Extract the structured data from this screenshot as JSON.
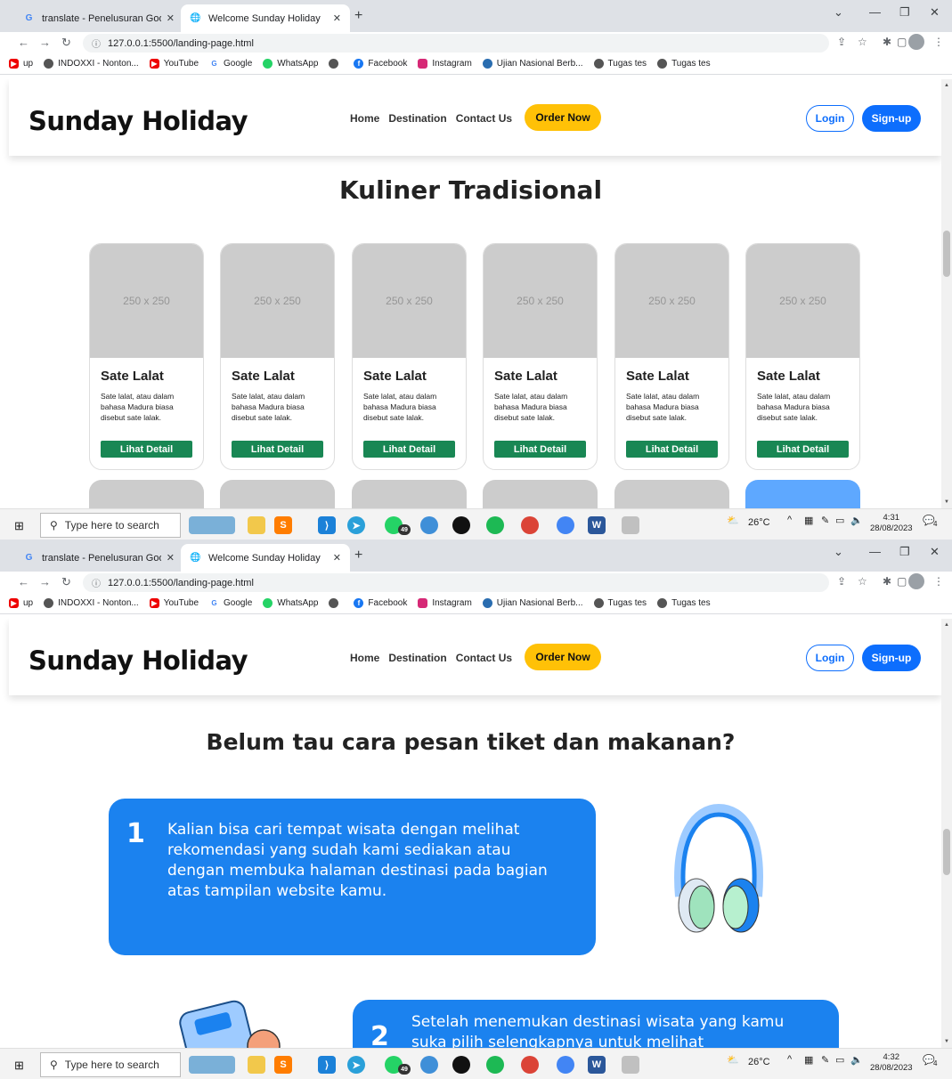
{
  "browser": {
    "tabs": [
      {
        "label": "translate - Penelusuran Google",
        "icon": "google-icon"
      },
      {
        "label": "Welcome Sunday Holiday",
        "icon": "globe-icon"
      }
    ],
    "new_tab": "+",
    "url": "127.0.0.1:5500/landing-page.html",
    "bookmarks": [
      "up",
      "INDOXXI - Nonton...",
      "YouTube",
      "Google",
      "WhatsApp",
      "",
      "Facebook",
      "Instagram",
      "Ujian Nasional Berb...",
      "Tugas tes",
      "Tugas tes"
    ]
  },
  "site": {
    "brand": "Sunday Holiday",
    "menu": [
      "Home",
      "Destination",
      "Contact Us"
    ],
    "order_label": "Order Now",
    "login_label": "Login",
    "signup_label": "Sign-up"
  },
  "section_kuliner": {
    "title": "Kuliner Tradisional",
    "cards": [
      {
        "img": "250 x 250",
        "name": "Sate Lalat",
        "desc": "Sate lalat, atau dalam bahasa Madura biasa disebut sate lalak.",
        "button": "Lihat Detail"
      },
      {
        "img": "250 x 250",
        "name": "Sate Lalat",
        "desc": "Sate lalat, atau dalam bahasa Madura biasa disebut sate lalak.",
        "button": "Lihat Detail"
      },
      {
        "img": "250 x 250",
        "name": "Sate Lalat",
        "desc": "Sate lalat, atau dalam bahasa Madura biasa disebut sate lalak.",
        "button": "Lihat Detail"
      },
      {
        "img": "250 x 250",
        "name": "Sate Lalat",
        "desc": "Sate lalat, atau dalam bahasa Madura biasa disebut sate lalak.",
        "button": "Lihat Detail"
      },
      {
        "img": "250 x 250",
        "name": "Sate Lalat",
        "desc": "Sate lalat, atau dalam bahasa Madura biasa disebut sate lalak.",
        "button": "Lihat Detail"
      },
      {
        "img": "250 x 250",
        "name": "Sate Lalat",
        "desc": "Sate lalat, atau dalam bahasa Madura biasa disebut sate lalak.",
        "button": "Lihat Detail"
      }
    ]
  },
  "section_howto": {
    "title": "Belum tau cara pesan tiket dan makanan?",
    "steps": [
      {
        "num": "1",
        "text": "Kalian bisa cari tempat wisata dengan melihat rekomendasi yang sudah kami sediakan atau dengan membuka halaman destinasi pada bagian atas tampilan website kamu."
      },
      {
        "num": "2",
        "text": "Setelah menemukan destinasi wisata yang kamu suka pilih selengkapnya untuk melihat"
      }
    ]
  },
  "taskbar": {
    "search_placeholder": "Type here to search",
    "whatsapp_badge": "49",
    "weather": "26°C",
    "shots": [
      {
        "time": "4:31",
        "date": "28/08/2023"
      },
      {
        "time": "4:32",
        "date": "28/08/2023"
      }
    ],
    "notifications": "4"
  },
  "colors": {
    "primary": "#0d6efd",
    "order": "#ffc107",
    "detail_button": "#198754",
    "step_box": "#1b82ef",
    "placeholder": "#cccccc"
  }
}
